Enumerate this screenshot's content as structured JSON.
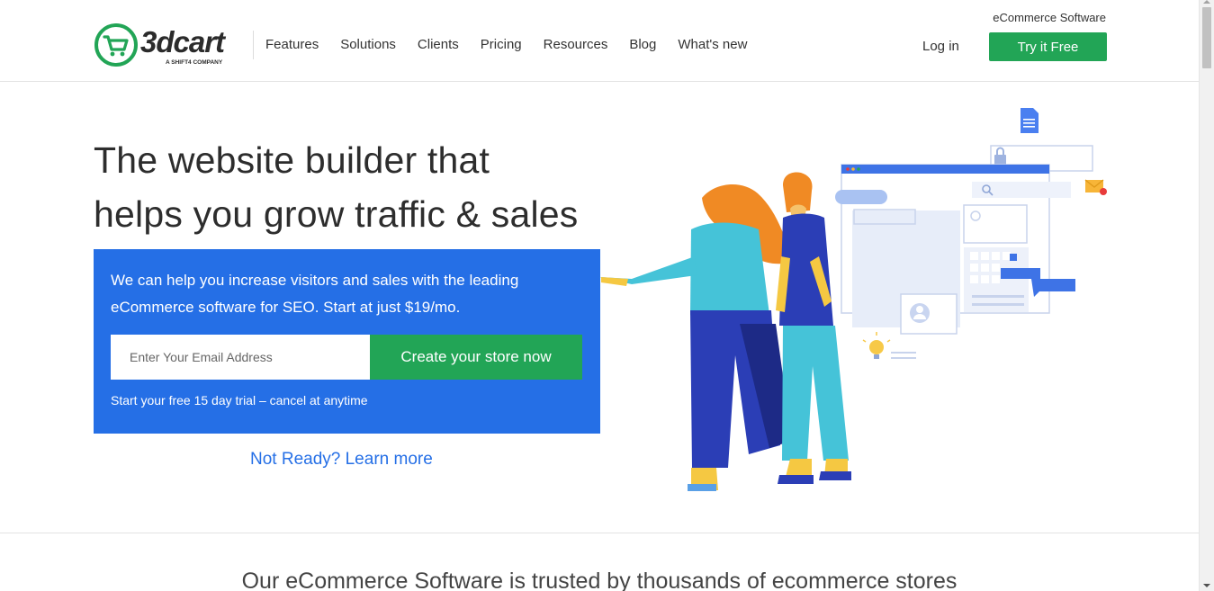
{
  "header": {
    "logo_text": "3dcart",
    "logo_subtext": "A SHIFT4 COMPANY",
    "tagline": "eCommerce Software",
    "nav": [
      "Features",
      "Solutions",
      "Clients",
      "Pricing",
      "Resources",
      "Blog",
      "What's new"
    ],
    "login_label": "Log in",
    "try_label": "Try it Free"
  },
  "hero": {
    "title_line1": "The website builder that",
    "title_line2": "helps you grow traffic & sales",
    "cta_text": "We can help you increase visitors and sales with the leading eCommerce software for SEO. Start at just $19/mo.",
    "email_placeholder": "Enter Your Email Address",
    "create_label": "Create your store now",
    "trial_note": "Start your free 15 day trial – cancel at anytime",
    "learn_more": "Not Ready? Learn more"
  },
  "trusted": {
    "text": "Our eCommerce Software is trusted by thousands of ecommerce stores"
  },
  "colors": {
    "brand_green": "#22a556",
    "brand_blue": "#256fe6"
  },
  "icons": [
    "cart-icon",
    "document-icon",
    "lock-icon",
    "search-icon",
    "mail-icon",
    "user-icon",
    "lightbulb-icon"
  ]
}
